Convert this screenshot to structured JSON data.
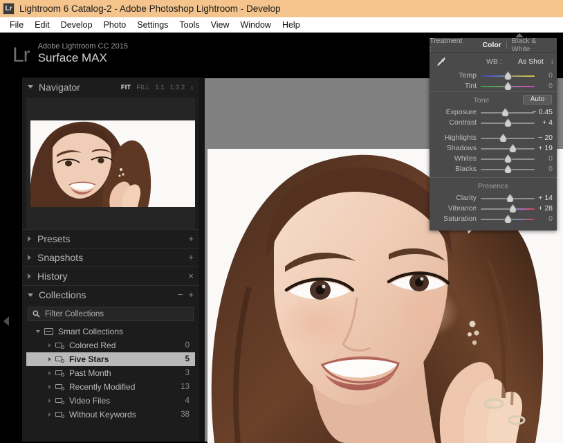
{
  "titlebar": {
    "icon": "lightroom-app-icon",
    "icon_text": "Lr",
    "title": "Lightroom 6 Catalog-2 - Adobe Photoshop Lightroom - Develop",
    "bg": "#f4c48c"
  },
  "menubar": {
    "items": [
      {
        "label": "File"
      },
      {
        "label": "Edit"
      },
      {
        "label": "Develop"
      },
      {
        "label": "Photo"
      },
      {
        "label": "Settings"
      },
      {
        "label": "Tools"
      },
      {
        "label": "View"
      },
      {
        "label": "Window"
      },
      {
        "label": "Help"
      }
    ]
  },
  "identity": {
    "logo": "Lr",
    "line1": "Adobe Lightroom CC 2015",
    "line2": "Surface MAX"
  },
  "left_panel": {
    "navigator": {
      "title": "Navigator",
      "zoom_options": [
        {
          "label": "FIT",
          "active": true
        },
        {
          "label": "FILL",
          "active": false
        },
        {
          "label": "1:1",
          "active": false
        },
        {
          "label": "1:3.2",
          "active": false
        }
      ],
      "stepper": "↕"
    },
    "presets": {
      "title": "Presets",
      "action": "+"
    },
    "snapshots": {
      "title": "Snapshots",
      "action": "+"
    },
    "history": {
      "title": "History",
      "action": "×"
    },
    "collections": {
      "title": "Collections",
      "action_minus": "−",
      "action_plus": "+",
      "filter_placeholder": "Filter Collections",
      "group": {
        "label": "Smart Collections",
        "expanded": true
      },
      "items": [
        {
          "label": "Colored Red",
          "count": "0",
          "selected": false
        },
        {
          "label": "Five Stars",
          "count": "5",
          "selected": true
        },
        {
          "label": "Past Month",
          "count": "3",
          "selected": false
        },
        {
          "label": "Recently Modified",
          "count": "13",
          "selected": false
        },
        {
          "label": "Video Files",
          "count": "4",
          "selected": false
        },
        {
          "label": "Without Keywords",
          "count": "38",
          "selected": false
        }
      ]
    }
  },
  "basic_panel": {
    "treatment": {
      "label": "Treatment :",
      "options": [
        {
          "label": "Color",
          "active": true
        },
        {
          "label": "Black & White",
          "active": false
        }
      ]
    },
    "white_balance": {
      "icon": "eyedropper-icon",
      "label": "WB :",
      "value": "As Shot",
      "caret": "↕",
      "sliders": [
        {
          "name": "Temp",
          "value": "0",
          "pos": 50,
          "gradient": "temp",
          "zero": true
        },
        {
          "name": "Tint",
          "value": "0",
          "pos": 50,
          "gradient": "tint",
          "zero": true
        }
      ]
    },
    "tone": {
      "title": "Tone",
      "auto_label": "Auto",
      "sliders": [
        {
          "name": "Exposure",
          "value": "− 0.45",
          "pos": 46,
          "gradient": "",
          "zero": false
        },
        {
          "name": "Contrast",
          "value": "+ 4",
          "pos": 51,
          "gradient": "",
          "zero": false
        },
        {
          "name": "Highlights",
          "value": "− 20",
          "pos": 42,
          "gradient": "",
          "zero": false
        },
        {
          "name": "Shadows",
          "value": "+ 19",
          "pos": 59,
          "gradient": "",
          "zero": false
        },
        {
          "name": "Whites",
          "value": "0",
          "pos": 50,
          "gradient": "",
          "zero": true
        },
        {
          "name": "Blacks",
          "value": "0",
          "pos": 50,
          "gradient": "",
          "zero": true
        }
      ]
    },
    "presence": {
      "title": "Presence",
      "sliders": [
        {
          "name": "Clarity",
          "value": "+ 14",
          "pos": 55,
          "gradient": "",
          "zero": false
        },
        {
          "name": "Vibrance",
          "value": "+ 28",
          "pos": 59,
          "gradient": "vib",
          "zero": false
        },
        {
          "name": "Saturation",
          "value": "0",
          "pos": 50,
          "gradient": "sat",
          "zero": true
        }
      ]
    }
  },
  "canvas": {
    "background": "#808080",
    "photo_alt": "portrait-photo"
  }
}
